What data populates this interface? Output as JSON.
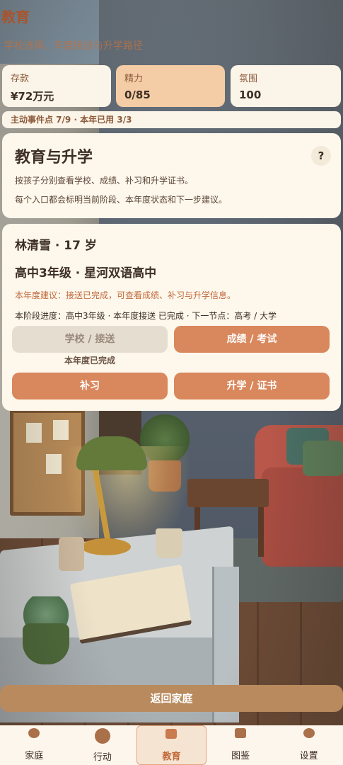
{
  "header": {
    "title": "教育",
    "subtitle": "学校选择、年度接送与升学路径"
  },
  "stats": [
    {
      "label": "存款",
      "value": "¥72万元"
    },
    {
      "label": "精力",
      "value": "0/85"
    },
    {
      "label": "氛围",
      "value": "100"
    }
  ],
  "events_text": "主动事件点 7/9 · 本年已用 3/3",
  "info": {
    "title": "教育与升学",
    "help": "?",
    "line1": "按孩子分别查看学校、成绩、补习和升学证书。",
    "line2": "每个入口都会标明当前阶段、本年度状态和下一步建议。"
  },
  "child": {
    "name": "林清雪 · 17 岁",
    "school": "高中3年级 · 星河双语高中",
    "advice": "本年度建议：接送已完成，可查看成绩、补习与升学信息。",
    "progress": "本阶段进度：高中3年级 · 本年度接送 已完成 · 下一节点：高考 / 大学",
    "buttons": {
      "school": "学校 / 接送",
      "grades": "成绩 / 考试",
      "tutoring": "补习",
      "advance": "升学 / 证书"
    },
    "school_status": "本年度已完成"
  },
  "return_label": "返回家庭",
  "nav": [
    {
      "label": "家庭",
      "icon": "family-icon"
    },
    {
      "label": "行动",
      "icon": "action-icon"
    },
    {
      "label": "教育",
      "icon": "education-icon",
      "active": true
    },
    {
      "label": "图鉴",
      "icon": "collection-icon"
    },
    {
      "label": "设置",
      "icon": "settings-icon"
    }
  ]
}
